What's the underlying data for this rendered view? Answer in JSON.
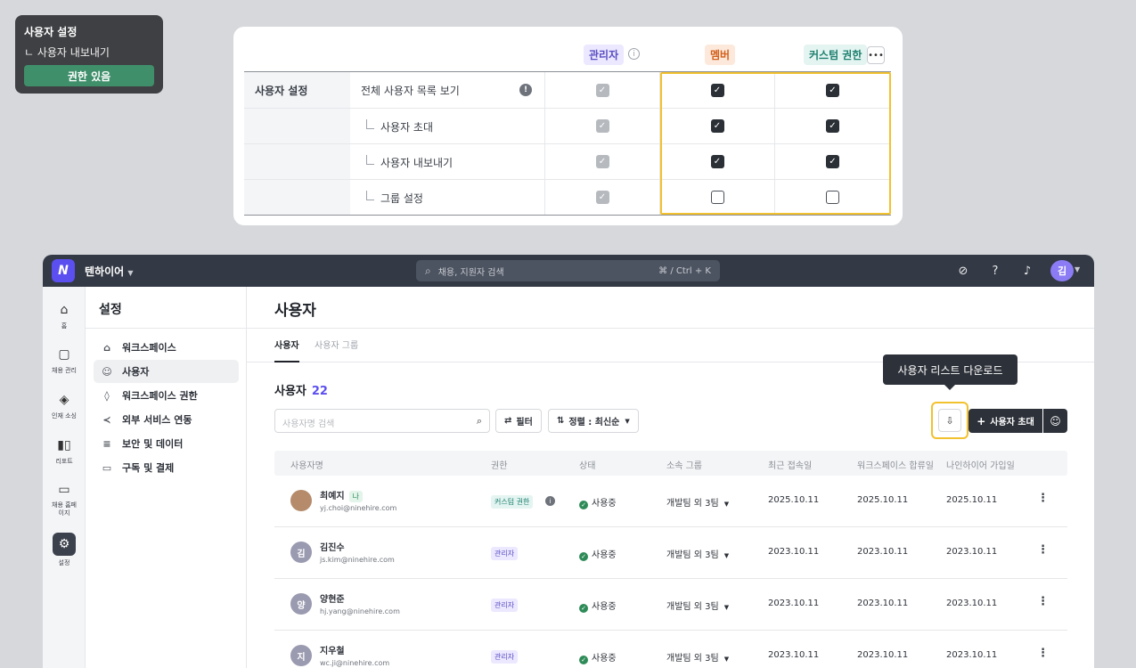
{
  "tooltip_card": {
    "title": "사용자 설정",
    "subtitle": "ㄴ 사용자 내보내기",
    "button": "권한 있음"
  },
  "permission_table": {
    "headers": {
      "admin": "관리자",
      "member": "멤버",
      "custom": "커스텀 권한"
    },
    "category": "사용자 설정",
    "rows": [
      {
        "name": "전체 사용자 목록 보기",
        "admin": "disabled-checked",
        "member": "checked",
        "custom": "checked"
      },
      {
        "name": "사용자 초대",
        "admin": "disabled-checked",
        "member": "checked",
        "custom": "checked"
      },
      {
        "name": "사용자 내보내기",
        "admin": "disabled-checked",
        "member": "checked",
        "custom": "checked"
      },
      {
        "name": "그룹 설정",
        "admin": "disabled-checked",
        "member": "unchecked",
        "custom": "unchecked"
      }
    ]
  },
  "topbar": {
    "workspace": "텐하이어",
    "search_placeholder": "채용, 지원자 검색",
    "shortcut": "⌘ / Ctrl + K",
    "avatar": "김"
  },
  "rail": [
    {
      "label": "홈",
      "icon": "home-icon"
    },
    {
      "label": "채용 관리",
      "icon": "note-icon"
    },
    {
      "label": "인재 소싱",
      "icon": "layers-icon"
    },
    {
      "label": "리포트",
      "icon": "bar-chart-icon"
    },
    {
      "label": "채용 홈페이지",
      "icon": "monitor-icon"
    },
    {
      "label": "설정",
      "icon": "gear-icon"
    }
  ],
  "settings_nav": {
    "title": "설정",
    "items": [
      {
        "label": "워크스페이스",
        "icon": "building-icon"
      },
      {
        "label": "사용자",
        "icon": "users-icon"
      },
      {
        "label": "워크스페이스 권한",
        "icon": "shield-icon"
      },
      {
        "label": "외부 서비스 연동",
        "icon": "share-icon"
      },
      {
        "label": "보안 및 데이터",
        "icon": "database-icon"
      },
      {
        "label": "구독 및 결제",
        "icon": "card-icon"
      }
    ]
  },
  "main": {
    "title": "사용자",
    "tabs": [
      "사용자",
      "사용자 그룹"
    ],
    "count_label": "사용자",
    "count": "22",
    "search_placeholder": "사용자명 검색",
    "filter": "필터",
    "sort": "정렬 : 최신순",
    "tooltip": "사용자 리스트 다운로드",
    "invite": "사용자 초대"
  },
  "user_table": {
    "columns": [
      "사용자명",
      "권한",
      "상태",
      "소속 그룹",
      "최근 접속일",
      "워크스페이스 합류일",
      "나인하이어 가입일"
    ],
    "rows": [
      {
        "avatar": "",
        "name": "최예지",
        "tag": "나",
        "email": "yj.choi@ninehire.com",
        "role": "커스텀 권한",
        "role_type": "custom",
        "status": "사용중",
        "group": "개발팀 외 3팀",
        "last": "2025.10.11",
        "joined": "2025.10.11",
        "signup": "2025.10.11"
      },
      {
        "avatar": "김",
        "name": "김진수",
        "tag": "",
        "email": "js.kim@ninehire.com",
        "role": "관리자",
        "role_type": "admin",
        "status": "사용중",
        "group": "개발팀 외 3팀",
        "last": "2023.10.11",
        "joined": "2023.10.11",
        "signup": "2023.10.11"
      },
      {
        "avatar": "양",
        "name": "양현준",
        "tag": "",
        "email": "hj.yang@ninehire.com",
        "role": "관리자",
        "role_type": "admin",
        "status": "사용중",
        "group": "개발팀 외 3팀",
        "last": "2023.10.11",
        "joined": "2023.10.11",
        "signup": "2023.10.11"
      },
      {
        "avatar": "지",
        "name": "지우철",
        "tag": "",
        "email": "wc.ji@ninehire.com",
        "role": "관리자",
        "role_type": "admin",
        "status": "사용중",
        "group": "개발팀 외 3팀",
        "last": "2023.10.11",
        "joined": "2023.10.11",
        "signup": "2023.10.11"
      }
    ]
  }
}
